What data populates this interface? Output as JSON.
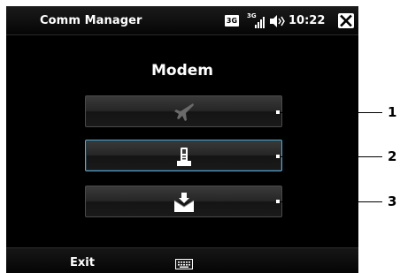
{
  "status_bar": {
    "app_title": "Comm Manager",
    "network_badge": "3G",
    "signal_tag": "3G",
    "time": "10:22",
    "icons": [
      "signal-icon",
      "speaker-icon",
      "close-icon"
    ]
  },
  "page": {
    "title": "Modem"
  },
  "buttons": [
    {
      "icon": "airplane-icon",
      "enabled": false,
      "selected": false
    },
    {
      "icon": "phone-modem-icon",
      "enabled": true,
      "selected": true
    },
    {
      "icon": "envelope-download-icon",
      "enabled": true,
      "selected": false
    }
  ],
  "softkeys": {
    "left": "Exit",
    "center_icon": "keyboard-icon"
  },
  "callouts": [
    "1",
    "2",
    "3"
  ],
  "colors": {
    "screen_bg": "#000000",
    "selected_border": "#5fa8c8",
    "disabled_icon": "#6a6a6a"
  }
}
